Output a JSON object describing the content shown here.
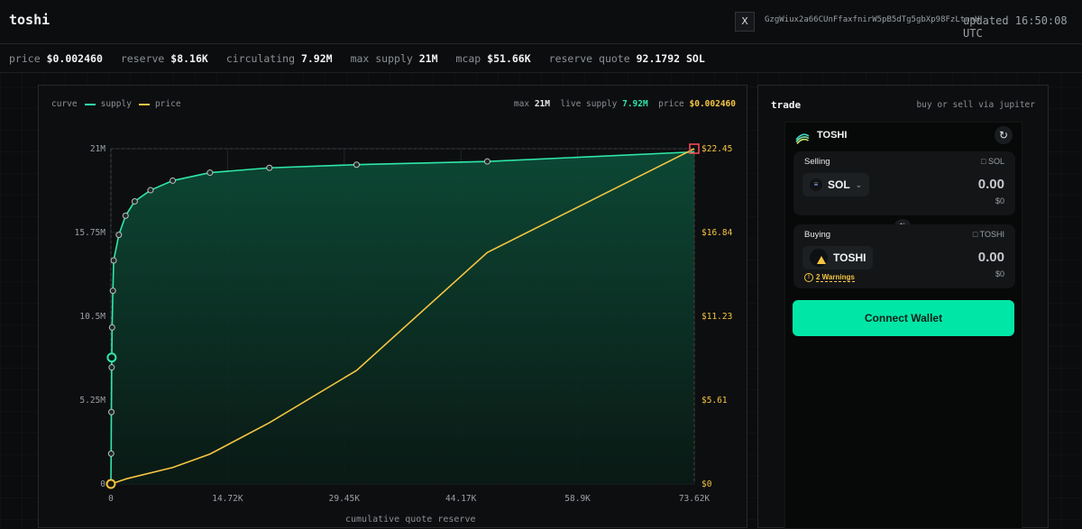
{
  "app": {
    "title": "toshi"
  },
  "header": {
    "x_label": "X",
    "address": "GzgWiux2a66CUnFfaxfnirW5pB5dTg5gbXp98FzLtnnH",
    "updated": "updated 16:50:08 UTC"
  },
  "stats": [
    {
      "label": "price",
      "value": "$0.002460"
    },
    {
      "label": "reserve",
      "value": "$8.16K"
    },
    {
      "label": "circulating",
      "value": "7.92M"
    },
    {
      "label": "max supply",
      "value": "21M"
    },
    {
      "label": "mcap",
      "value": "$51.66K"
    },
    {
      "label": "reserve quote",
      "value": "92.1792 SOL"
    }
  ],
  "chart_panel": {
    "legend_title": "curve",
    "legend_supply": "supply",
    "legend_price": "price",
    "max_label": "max",
    "max_value": "21M",
    "live_label": "live supply",
    "live_value": "7.92M",
    "price_label": "price",
    "price_value": "$0.002460",
    "xlabel": "cumulative quote reserve"
  },
  "colors": {
    "supply": "#2ee8a8",
    "price": "#f5c542",
    "accent": "#00e6a6",
    "marker_max": "#ff4d5a"
  },
  "chart_data": {
    "type": "line",
    "x_ticks": [
      "0",
      "14.72K",
      "29.45K",
      "44.17K",
      "58.9K",
      "73.62K"
    ],
    "y_left_ticks": [
      "0",
      "5.25M",
      "10.5M",
      "15.75M",
      "21M"
    ],
    "y_right_ticks": [
      "$0",
      "$5.61",
      "$11.23",
      "$16.84",
      "$22.45"
    ],
    "xlim": [
      0,
      73620
    ],
    "ylim_left": [
      0,
      21000000
    ],
    "ylim_right": [
      0,
      22.45
    ],
    "xlabel": "cumulative quote reserve",
    "series": [
      {
        "name": "supply",
        "axis": "left",
        "points": [
          [
            0,
            0
          ],
          [
            30,
            1900000
          ],
          [
            60,
            4500000
          ],
          [
            100,
            7300000
          ],
          [
            150,
            9800000
          ],
          [
            250,
            12100000
          ],
          [
            350,
            14000000
          ],
          [
            1000,
            15600000
          ],
          [
            1850,
            16800000
          ],
          [
            3000,
            17700000
          ],
          [
            5000,
            18400000
          ],
          [
            7800,
            19000000
          ],
          [
            12500,
            19500000
          ],
          [
            20000,
            19800000
          ],
          [
            31000,
            20000000
          ],
          [
            47500,
            20200000
          ],
          [
            73620,
            20800000
          ]
        ],
        "markers": [
          [
            0,
            0
          ],
          [
            30,
            1900000
          ],
          [
            60,
            4500000
          ],
          [
            100,
            7300000
          ],
          [
            150,
            9800000
          ],
          [
            250,
            12100000
          ],
          [
            350,
            14000000
          ],
          [
            1000,
            15600000
          ],
          [
            1850,
            16800000
          ],
          [
            3000,
            17700000
          ],
          [
            5000,
            18400000
          ],
          [
            7800,
            19000000
          ],
          [
            12500,
            19500000
          ],
          [
            20000,
            19800000
          ],
          [
            31000,
            20000000
          ],
          [
            47500,
            20200000
          ]
        ]
      },
      {
        "name": "price",
        "axis": "right",
        "points": [
          [
            0,
            0
          ],
          [
            2000,
            0.35
          ],
          [
            7800,
            1.1
          ],
          [
            12500,
            2.0
          ],
          [
            20000,
            4.1
          ],
          [
            31000,
            7.6
          ],
          [
            47500,
            15.5
          ],
          [
            73620,
            22.45
          ]
        ]
      }
    ],
    "current_point": {
      "x": 100,
      "supply": 7920000,
      "price": 0.00246
    },
    "max_point": {
      "x": 73620,
      "supply": 21000000,
      "price": 22.45
    }
  },
  "trade": {
    "title": "trade",
    "subtitle": "buy or sell via jupiter",
    "token_name": "TOSHI",
    "selling": {
      "label": "Selling",
      "balance_token": "SOL",
      "token": "SOL",
      "amount": "0.00",
      "usd": "$0"
    },
    "buying": {
      "label": "Buying",
      "balance_token": "TOSHI",
      "token": "TOSHI",
      "amount": "0.00",
      "usd": "$0",
      "warnings": "2 Warnings"
    },
    "connect_label": "Connect Wallet"
  }
}
